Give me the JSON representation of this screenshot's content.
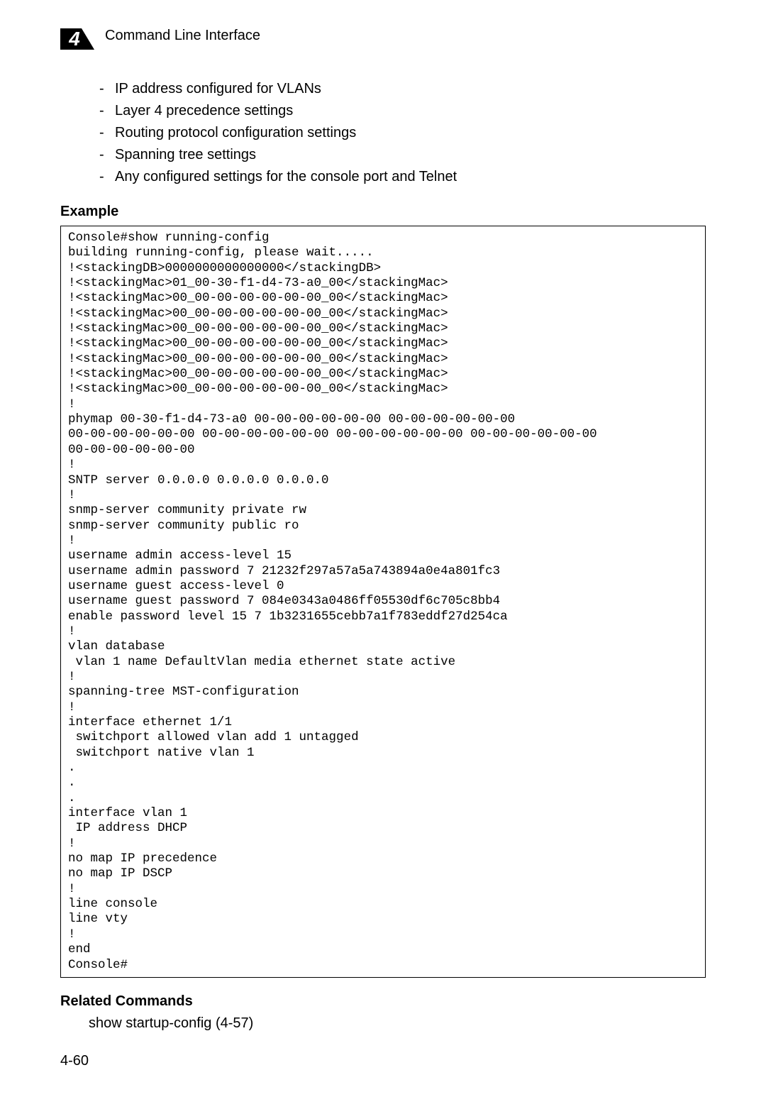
{
  "header": {
    "chapter_number": "4",
    "title": "Command Line Interface"
  },
  "bullets": {
    "items": [
      "IP address configured for VLANs",
      "Layer 4 precedence settings",
      "Routing protocol configuration settings",
      "Spanning tree settings",
      "Any configured settings for the console port and Telnet"
    ]
  },
  "example": {
    "heading": "Example",
    "code": "Console#show running-config\nbuilding running-config, please wait.....\n!<stackingDB>0000000000000000</stackingDB>\n!<stackingMac>01_00-30-f1-d4-73-a0_00</stackingMac>\n!<stackingMac>00_00-00-00-00-00-00_00</stackingMac>\n!<stackingMac>00_00-00-00-00-00-00_00</stackingMac>\n!<stackingMac>00_00-00-00-00-00-00_00</stackingMac>\n!<stackingMac>00_00-00-00-00-00-00_00</stackingMac>\n!<stackingMac>00_00-00-00-00-00-00_00</stackingMac>\n!<stackingMac>00_00-00-00-00-00-00_00</stackingMac>\n!<stackingMac>00_00-00-00-00-00-00_00</stackingMac>\n!\nphymap 00-30-f1-d4-73-a0 00-00-00-00-00-00 00-00-00-00-00-00 \n00-00-00-00-00-00 00-00-00-00-00-00 00-00-00-00-00-00 00-00-00-00-00-00 \n00-00-00-00-00-00\n!\nSNTP server 0.0.0.0 0.0.0.0 0.0.0.0\n!\nsnmp-server community private rw\nsnmp-server community public ro\n!\nusername admin access-level 15\nusername admin password 7 21232f297a57a5a743894a0e4a801fc3\nusername guest access-level 0\nusername guest password 7 084e0343a0486ff05530df6c705c8bb4\nenable password level 15 7 1b3231655cebb7a1f783eddf27d254ca\n!\nvlan database\n vlan 1 name DefaultVlan media ethernet state active\n!\nspanning-tree MST-configuration\n!\ninterface ethernet 1/1\n switchport allowed vlan add 1 untagged\n switchport native vlan 1\n.\n.\n.\ninterface vlan 1\n IP address DHCP\n!\nno map IP precedence\nno map IP DSCP\n!\nline console\nline vty\n!\nend\nConsole#"
  },
  "related": {
    "heading": "Related Commands",
    "body": "show startup-config (4-57)"
  },
  "footer": {
    "page_number": "4-60"
  }
}
